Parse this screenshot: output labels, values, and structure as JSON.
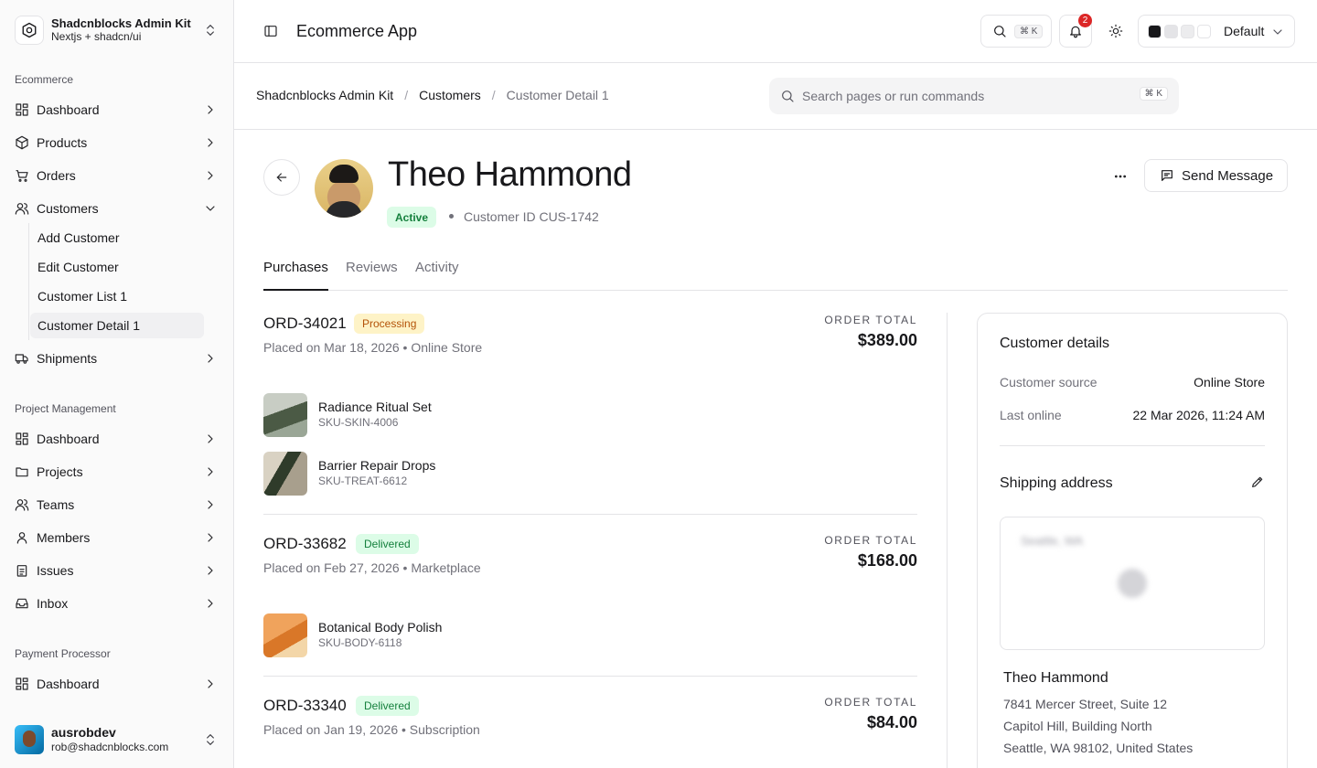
{
  "sidebar": {
    "brand_title": "Shadcnblocks Admin Kit",
    "brand_sub": "Nextjs + shadcn/ui",
    "groups": {
      "ecommerce": "Ecommerce",
      "project": "Project Management",
      "payment": "Payment Processor"
    },
    "ecommerce_items": [
      "Dashboard",
      "Products",
      "Orders",
      "Customers",
      "Shipments"
    ],
    "customers_sub": [
      "Add Customer",
      "Edit Customer",
      "Customer List 1",
      "Customer Detail 1"
    ],
    "project_items": [
      "Dashboard",
      "Projects",
      "Teams",
      "Members",
      "Issues",
      "Inbox"
    ],
    "payment_items": [
      "Dashboard"
    ],
    "user": {
      "name": "ausrobdev",
      "email": "rob@shadcnblocks.com"
    }
  },
  "topbar": {
    "title": "Ecommerce App",
    "search_kbd": "⌘ K",
    "notification_count": "2",
    "theme": "Default",
    "swatches": [
      "#18181b",
      "#e4e4e7",
      "#ececee",
      "#ffffff"
    ]
  },
  "breadcrumb": {
    "items": [
      "Shadcnblocks Admin Kit",
      "Customers",
      "Customer Detail 1"
    ],
    "search_placeholder": "Search pages or run commands",
    "search_kbd": "⌘ K"
  },
  "profile": {
    "name": "Theo Hammond",
    "status": "Active",
    "customer_id": "Customer ID CUS-1742",
    "send_label": "Send Message"
  },
  "tabs": [
    "Purchases",
    "Reviews",
    "Activity"
  ],
  "orders": [
    {
      "id": "ORD-34021",
      "status": "Processing",
      "meta": "Placed on Mar 18, 2026 • Online Store",
      "total_label": "ORDER TOTAL",
      "total": "$389.00",
      "products": [
        {
          "name": "Radiance Ritual Set",
          "sku": "SKU-SKIN-4006"
        },
        {
          "name": "Barrier Repair Drops",
          "sku": "SKU-TREAT-6612"
        }
      ]
    },
    {
      "id": "ORD-33682",
      "status": "Delivered",
      "meta": "Placed on Feb 27, 2026 • Marketplace",
      "total_label": "ORDER TOTAL",
      "total": "$168.00",
      "products": [
        {
          "name": "Botanical Body Polish",
          "sku": "SKU-BODY-6118"
        }
      ]
    },
    {
      "id": "ORD-33340",
      "status": "Delivered",
      "meta": "Placed on Jan 19, 2026 • Subscription",
      "total_label": "ORDER TOTAL",
      "total": "$84.00",
      "products": []
    }
  ],
  "details": {
    "title": "Customer details",
    "source_label": "Customer source",
    "source_value": "Online Store",
    "online_label": "Last online",
    "online_value": "22 Mar 2026, 11:24 AM",
    "shipping_title": "Shipping address",
    "map_label": "Seattle, WA",
    "address": {
      "name": "Theo Hammond",
      "line1": "7841 Mercer Street, Suite 12",
      "line2": "Capitol Hill, Building North",
      "line3": "Seattle, WA 98102, United States"
    }
  }
}
